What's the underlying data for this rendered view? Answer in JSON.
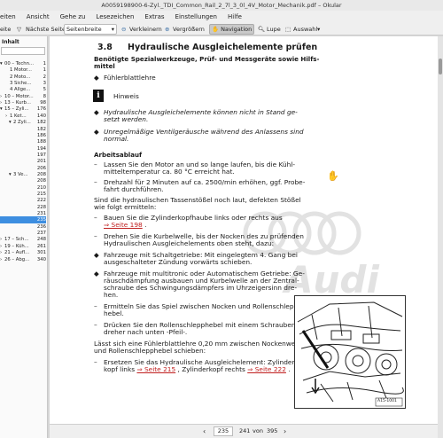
{
  "window": {
    "title": "A0059198900-6-Zyl._TDI_Common_Rail_2_7l_3_0l_4V_Motor_Mechanik.pdf – Okular"
  },
  "menu": [
    "eiten",
    "Ansicht",
    "Gehe zu",
    "Lesezeichen",
    "Extras",
    "Einstellungen",
    "Hilfe"
  ],
  "toolbar": {
    "prev": "eite",
    "next": "Nächste Seite",
    "width_mode": "Seitenbreite",
    "zoom_out": "Verkleinern",
    "zoom_in": "Vergrößern",
    "navigation": "Navigation",
    "lupe": "Lupe",
    "select": "Auswahl"
  },
  "sidebar": {
    "title": "Inhalt",
    "rows": [
      {
        "label": "00 – Techn...",
        "page": "1"
      },
      {
        "label": "1 Motor...",
        "page": "1"
      },
      {
        "label": "2 Moto...",
        "page": "2"
      },
      {
        "label": "3 Siche...",
        "page": "3"
      },
      {
        "label": "4 Allge...",
        "page": "5"
      },
      {
        "label": "10 – Motor...",
        "page": "8"
      },
      {
        "label": "13 – Kurb...",
        "page": "98"
      },
      {
        "label": "15 – Zyli...",
        "page": "176"
      },
      {
        "label": "1 Ket...",
        "page": "140"
      },
      {
        "label": "2 Zyli...",
        "page": "182"
      },
      {
        "label": "",
        "page": "182"
      },
      {
        "label": "",
        "page": "186"
      },
      {
        "label": "",
        "page": "188"
      },
      {
        "label": "",
        "page": "194"
      },
      {
        "label": "",
        "page": "197"
      },
      {
        "label": "",
        "page": "201"
      },
      {
        "label": "",
        "page": "206"
      },
      {
        "label": "3 Ve...",
        "page": "208"
      },
      {
        "label": "",
        "page": "208"
      },
      {
        "label": "",
        "page": "210"
      },
      {
        "label": "",
        "page": "215"
      },
      {
        "label": "",
        "page": "222"
      },
      {
        "label": "",
        "page": "228"
      },
      {
        "label": "",
        "page": "231"
      },
      {
        "label": "",
        "page": "235"
      },
      {
        "label": "",
        "page": "236"
      },
      {
        "label": "",
        "page": "237"
      },
      {
        "label": "17 – Sch...",
        "page": "248"
      },
      {
        "label": "19 – Küh...",
        "page": "261"
      },
      {
        "label": "21 – Aufl...",
        "page": "301"
      },
      {
        "label": "26 – Abg...",
        "page": "340"
      }
    ]
  },
  "doc": {
    "section_num": "3.8",
    "section_title": "Hydraulische Ausgleichelemente prüfen",
    "tools_l1": "Benötigte Spezialwerkzeuge, Prüf- und Messgeräte sowie Hilfs-",
    "tools_l2": "mittel",
    "bullet1": "Fühlerblattlehre",
    "hinweis": "Hinweis",
    "hin1_l1": "Hydraulische Ausgleichelemente können nicht in Stand ge-",
    "hin1_l2": "setzt werden.",
    "hin2_l1": "Unregelmäßige Ventilgeräusche während des Anlassens sind",
    "hin2_l2": "normal.",
    "arbeitsablauf": "Arbeitsablauf",
    "s1_l1": "Lassen Sie den Motor an und so lange laufen, bis die Kühl-",
    "s1_l2": "mitteltemperatur ca. 80 °C erreicht hat.",
    "s2_l1": "Drehzahl für 2 Minuten auf ca. 2500/min erhöhen, ggf. Probe-",
    "s2_l2": "fahrt durchführen.",
    "p1_l1": "Sind die hydraulischen Tassenstößel noch laut, defekten Stößel",
    "p1_l2": "wie folgt ermitteln:",
    "s3_l1": "Bauen Sie die Zylinderkopfhaube links oder rechts aus",
    "s3_link": "⇒ Seite 198",
    "s3_end": " .",
    "s4_l1": "Drehen Sie die Kurbelwelle, bis der Nocken des zu prüfenden",
    "s4_l2": "Hydraulischen Ausgleichelements oben steht, dazu:",
    "b2_l1": "Fahrzeuge mit Schaltgetriebe: Mit eingelegtem 4. Gang bei",
    "b2_l2": "ausgeschalteter Zündung vorwärts schieben.",
    "b3_l1": "Fahrzeuge mit multitronic oder Automatischem Getriebe: Ge-",
    "b3_l2": "räuschdämpfung ausbauen und Kurbelwelle an der Zentral-",
    "b3_l3": "schraube des Schwingungsdämpfers im Uhrzeigersinn dre-",
    "b3_l4": "hen.",
    "s5_l1": "Ermitteln Sie das Spiel zwischen Nocken und Rollenschlepp-",
    "s5_l2": "hebel.",
    "s6_l1": "Drücken Sie den Rollenschlepphebel mit einem Schrauben-",
    "s6_l2": "dreher nach unten -Pfeil-.",
    "p2_l1": "Lässt sich eine Fühlerblattlehre 0,20 mm zwischen Nockenwelle",
    "p2_l2": "und Rollenschlepphebel schieben:",
    "s7_l1": "Ersetzen Sie das Hydraulische Ausgleichelement: Zylinder-",
    "s7_l2": "kopf links ",
    "s7_link1": "⇒ Seite 215",
    "s7_mid": " , Zylinderkopf rechts ",
    "s7_link2": "⇒ Seite 222",
    "s7_end": " .",
    "dash": "–",
    "diamond": "◆",
    "figure_code": "A15-1001",
    "watermark": "Audi"
  },
  "status": {
    "current_page": "235",
    "page_label": "241",
    "of": "von",
    "total": "395"
  }
}
